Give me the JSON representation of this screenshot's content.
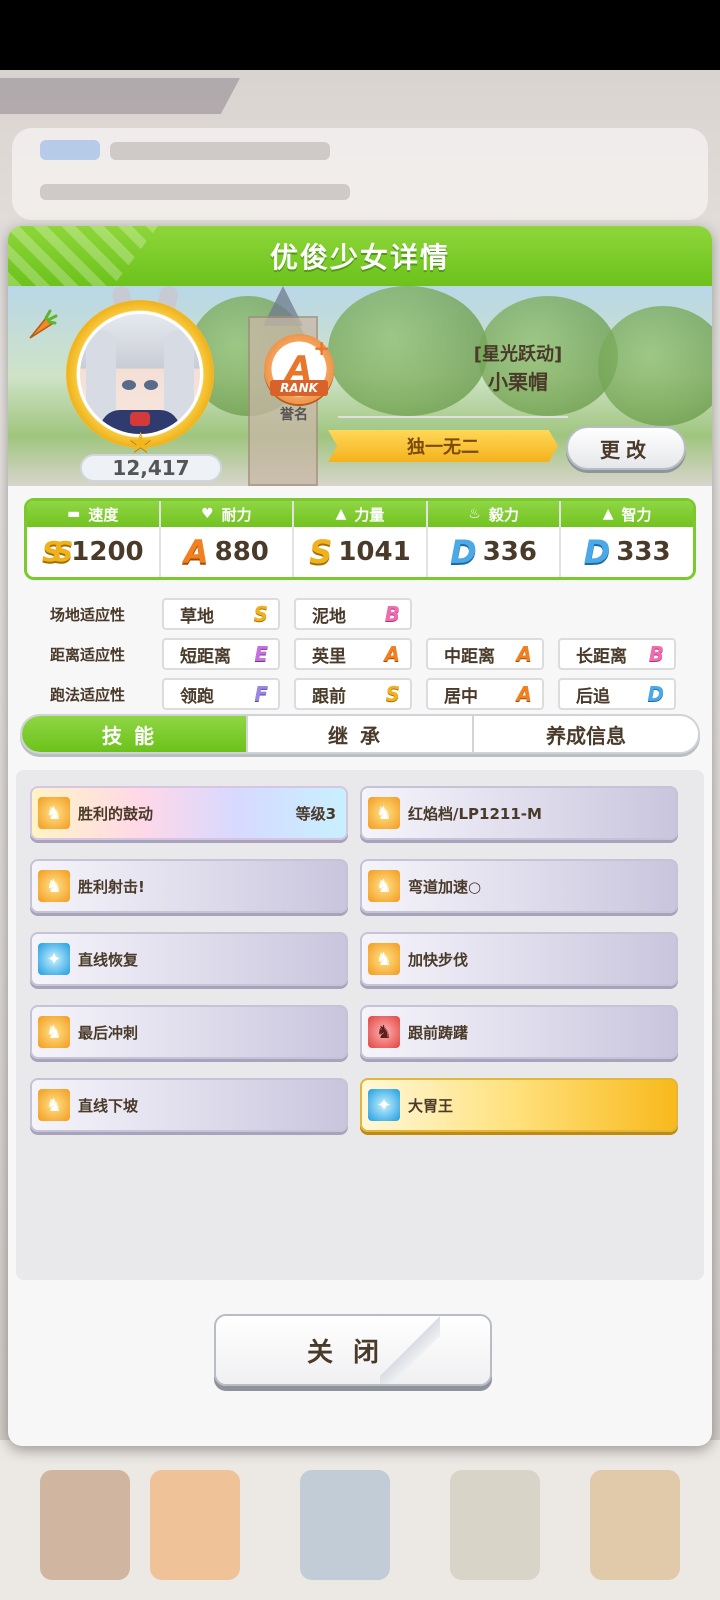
{
  "dialog": {
    "title": "优俊少女详情"
  },
  "character": {
    "fans": "12,417",
    "rank_grade": "A",
    "rank_plus": "+",
    "rank_word": "RANK",
    "rank_caption": "誉名",
    "epithet": "[星光跃动]",
    "name": "小栗帽",
    "unique_title": "独一无二",
    "change_label": "更改"
  },
  "stats": [
    {
      "label": "速度",
      "icon": "shoe-icon",
      "grade": "SS",
      "value": "1200"
    },
    {
      "label": "耐力",
      "icon": "heart-icon",
      "grade": "A",
      "value": "880"
    },
    {
      "label": "力量",
      "icon": "muscle-icon",
      "grade": "S",
      "value": "1041"
    },
    {
      "label": "毅力",
      "icon": "flame-icon",
      "grade": "D",
      "value": "336"
    },
    {
      "label": "智力",
      "icon": "graduation-cap-icon",
      "grade": "D",
      "value": "333"
    }
  ],
  "aptitudes": {
    "track": {
      "label": "场地适应性",
      "items": [
        {
          "name": "草地",
          "grade": "S"
        },
        {
          "name": "泥地",
          "grade": "B"
        }
      ]
    },
    "distance": {
      "label": "距离适应性",
      "items": [
        {
          "name": "短距离",
          "grade": "E"
        },
        {
          "name": "英里",
          "grade": "A"
        },
        {
          "name": "中距离",
          "grade": "A"
        },
        {
          "name": "长距离",
          "grade": "B"
        }
      ]
    },
    "strategy": {
      "label": "跑法适应性",
      "items": [
        {
          "name": "领跑",
          "grade": "F"
        },
        {
          "name": "跟前",
          "grade": "S"
        },
        {
          "name": "居中",
          "grade": "A"
        },
        {
          "name": "后追",
          "grade": "D"
        }
      ]
    }
  },
  "tabs": [
    {
      "label": "技能"
    },
    {
      "label": "继承"
    },
    {
      "label": "养成信息"
    }
  ],
  "skills": [
    {
      "name": "胜利的鼓动",
      "level": "等级3",
      "icon": "running-horse-icon",
      "style": "rainbow",
      "icon_color": "orange"
    },
    {
      "name": "红焰档/LP1211-M",
      "level": "",
      "icon": "running-horse-icon",
      "style": "normal",
      "icon_color": "orange"
    },
    {
      "name": "胜利射击!",
      "level": "",
      "icon": "running-horse-icon",
      "style": "normal",
      "icon_color": "orange"
    },
    {
      "name": "弯道加速○",
      "level": "",
      "icon": "running-horse-icon",
      "style": "normal",
      "icon_color": "orange"
    },
    {
      "name": "直线恢复",
      "level": "",
      "icon": "sparkle-icon",
      "style": "normal",
      "icon_color": "blue"
    },
    {
      "name": "加快步伐",
      "level": "",
      "icon": "running-horse-icon",
      "style": "normal",
      "icon_color": "orange"
    },
    {
      "name": "最后冲刺",
      "level": "",
      "icon": "running-horse-icon",
      "style": "normal",
      "icon_color": "orange"
    },
    {
      "name": "跟前踌躇",
      "level": "",
      "icon": "debuff-horse-icon",
      "style": "normal",
      "icon_color": "red"
    },
    {
      "name": "直线下坡",
      "level": "",
      "icon": "running-horse-icon",
      "style": "normal",
      "icon_color": "orange"
    },
    {
      "name": "大胃王",
      "level": "",
      "icon": "sparkle-icon",
      "style": "gold",
      "icon_color": "blue"
    }
  ],
  "close_label": "关闭"
}
